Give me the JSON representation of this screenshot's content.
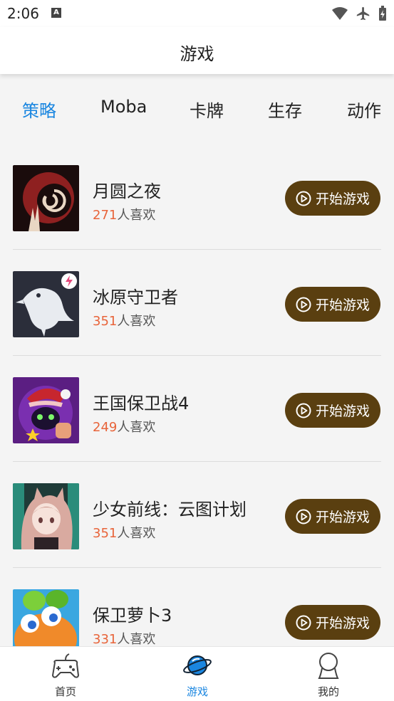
{
  "status": {
    "time": "2:06",
    "notif_glyph": "A"
  },
  "header": {
    "title": "游戏"
  },
  "tabs": [
    {
      "label": "策略",
      "active": true
    },
    {
      "label": "Moba"
    },
    {
      "label": "卡牌"
    },
    {
      "label": "生存"
    },
    {
      "label": "动作"
    }
  ],
  "games": [
    {
      "name": "月圆之夜",
      "likes": "271",
      "likes_suffix": "人喜欢",
      "button": "开始游戏",
      "icon": "moon-night-icon"
    },
    {
      "name": "冰原守卫者",
      "likes": "351",
      "likes_suffix": "人喜欢",
      "button": "开始游戏",
      "icon": "raven-icon"
    },
    {
      "name": "王国保卫战4",
      "likes": "249",
      "likes_suffix": "人喜欢",
      "button": "开始游戏",
      "icon": "kingdom-rush-icon"
    },
    {
      "name": "少女前线：云图计划",
      "likes": "351",
      "likes_suffix": "人喜欢",
      "button": "开始游戏",
      "icon": "anime-girl-icon"
    },
    {
      "name": "保卫萝卜3",
      "likes": "331",
      "likes_suffix": "人喜欢",
      "button": "开始游戏",
      "icon": "carrot-icon"
    }
  ],
  "bottom_nav": [
    {
      "label": "首页",
      "icon": "gamepad-icon"
    },
    {
      "label": "游戏",
      "icon": "planet-icon",
      "active": true
    },
    {
      "label": "我的",
      "icon": "user-icon"
    }
  ],
  "colors": {
    "accent": "#1a86e0",
    "button": "#5a3f10",
    "likes": "#e8643a"
  }
}
